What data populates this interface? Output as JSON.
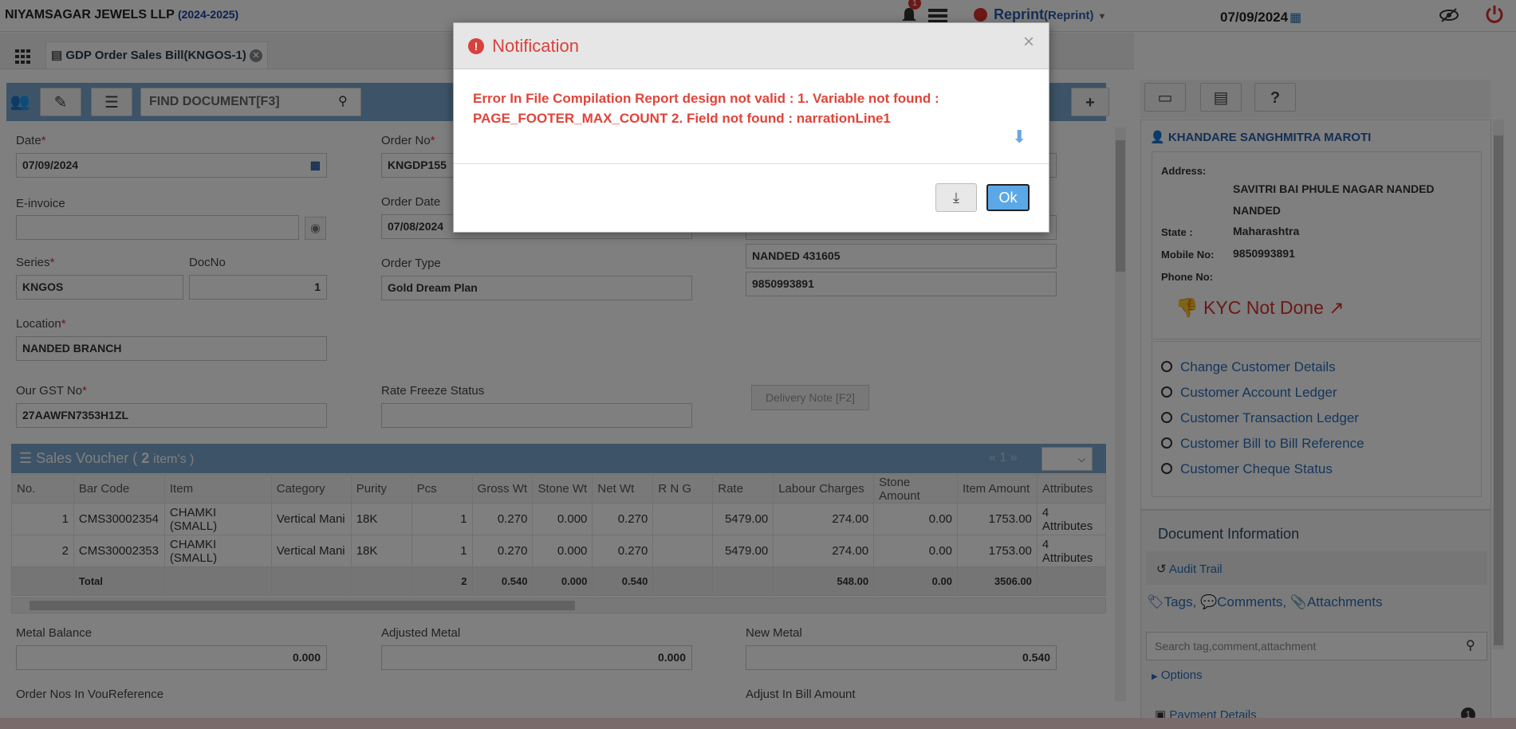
{
  "header": {
    "company": "NIYAMSAGAR JEWELS LLP",
    "year": "(2024-2025)",
    "notif_count": "1",
    "mode": "Reprint",
    "mode_sub": "(Reprint)",
    "date": "07/09/2024"
  },
  "tab": {
    "label": "GDP Order Sales Bill(KNGOS-1)"
  },
  "toolbar": {
    "find_placeholder": "FIND DOCUMENT[F3]"
  },
  "form": {
    "date_label": "Date",
    "date_value": "07/09/2024",
    "einvoice_label": "E-invoice",
    "einvoice_value": "",
    "series_label": "Series",
    "series_value": "KNGOS",
    "docno_label": "DocNo",
    "docno_value": "1",
    "location_label": "Location",
    "location_value": "NANDED BRANCH",
    "gst_label": "Our GST No",
    "gst_value": "27AAWFN7353H1ZL",
    "orderno_label": "Order No",
    "orderno_value": "KNGDP155",
    "orderdate_label": "Order Date",
    "orderdate_value": "07/08/2024",
    "ordertype_label": "Order Type",
    "ordertype_value": "Gold Dream Plan",
    "ratefreeze_label": "Rate Freeze Status",
    "ratefreeze_value": "",
    "addr_line1": "NANDED 431605",
    "addr_phone": "9850993891",
    "delivery_btn": "Delivery Note [F2]",
    "metal_balance_label": "Metal Balance",
    "metal_balance_value": "0.000",
    "adjusted_metal_label": "Adjusted Metal",
    "adjusted_metal_value": "0.000",
    "new_metal_label": "New Metal",
    "new_metal_value": "0.540",
    "order_nos_label": "Order Nos In VouReference",
    "adjust_bill_label": "Adjust In Bill Amount"
  },
  "voucher": {
    "title_prefix": "Sales Voucher (",
    "count": "2",
    "title_suffix": "item's )",
    "page": "1",
    "columns": [
      "No.",
      "Bar Code",
      "Item",
      "Category",
      "Purity",
      "Pcs",
      "Gross Wt",
      "Stone Wt",
      "Net Wt",
      "R N G",
      "Rate",
      "Labour Charges",
      "Stone Amount",
      "Item Amount",
      "Attributes"
    ],
    "rows": [
      [
        "1",
        "CMS30002354",
        "CHAMKI (SMALL)",
        "Vertical Mani",
        "18K",
        "1",
        "0.270",
        "0.000",
        "0.270",
        "",
        "5479.00",
        "274.00",
        "0.00",
        "1753.00",
        "4 Attributes"
      ],
      [
        "2",
        "CMS30002353",
        "CHAMKI (SMALL)",
        "Vertical Mani",
        "18K",
        "1",
        "0.270",
        "0.000",
        "0.270",
        "",
        "5479.00",
        "274.00",
        "0.00",
        "1753.00",
        "4 Attributes"
      ]
    ],
    "total": [
      "",
      "Total",
      "",
      "",
      "",
      "2",
      "0.540",
      "0.000",
      "0.540",
      "",
      "",
      "548.00",
      "0.00",
      "3506.00",
      ""
    ]
  },
  "customer": {
    "name": "KHANDARE SANGHMITRA MAROTI",
    "address_label": "Address:",
    "address": "SAVITRI BAI PHULE NAGAR NANDED NANDED",
    "state_label": "State :",
    "state": "Maharashtra",
    "mobile_label": "Mobile No:",
    "mobile": "9850993891",
    "phone_label": "Phone No:",
    "phone": "",
    "kyc": "KYC Not Done",
    "links": [
      "Change Customer Details",
      "Customer Account Ledger",
      "Customer Transaction Ledger",
      "Customer Bill to Bill Reference",
      "Customer Cheque Status"
    ]
  },
  "docinfo": {
    "title": "Document Information",
    "audit": "Audit Trail",
    "tags": "Tags,",
    "comments": "Comments,",
    "attachments": "Attachments",
    "search_placeholder": "Search tag,comment,attachment",
    "options": "Options",
    "payment": "Payment Details",
    "payment_count": "1"
  },
  "modal": {
    "title": "Notification",
    "message": "Error In File Compilation Report design not valid : 1. Variable not found : PAGE_FOOTER_MAX_COUNT 2. Field not found : narrationLine1",
    "ok": "Ok"
  },
  "colors": {
    "accent": "#7aa7cf",
    "error": "#e0443a",
    "link": "#2a6db8"
  }
}
